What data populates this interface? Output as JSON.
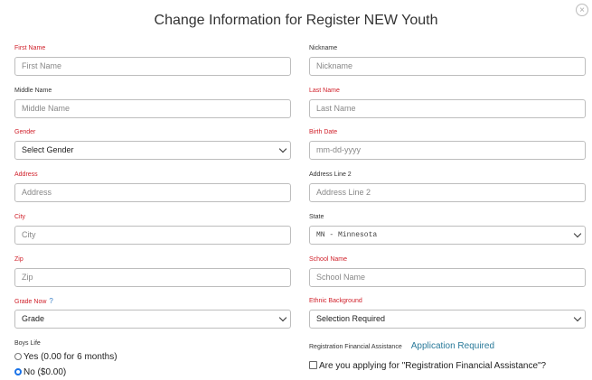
{
  "modal": {
    "title": "Change Information for Register NEW Youth",
    "close_glyph": "×"
  },
  "fields": {
    "first_name": {
      "label": "First Name",
      "placeholder": "First Name"
    },
    "nickname": {
      "label": "Nickname",
      "placeholder": "Nickname"
    },
    "middle_name": {
      "label": "Middle Name",
      "placeholder": "Middle Name"
    },
    "last_name": {
      "label": "Last Name",
      "placeholder": "Last Name"
    },
    "gender": {
      "label": "Gender",
      "value": "Select Gender"
    },
    "birth_date": {
      "label": "Birth Date",
      "placeholder": "mm-dd-yyyy"
    },
    "address": {
      "label": "Address",
      "placeholder": "Address"
    },
    "address2": {
      "label": "Address Line 2",
      "placeholder": "Address Line 2"
    },
    "city": {
      "label": "City",
      "placeholder": "City"
    },
    "state": {
      "label": "State",
      "value": "MN - Minnesota"
    },
    "zip": {
      "label": "Zip",
      "placeholder": "Zip"
    },
    "school": {
      "label": "School Name",
      "placeholder": "School Name"
    },
    "grade": {
      "label": "Grade Now",
      "help": "?",
      "value": "Grade"
    },
    "ethnic": {
      "label": "Ethnic Background",
      "value": "Selection Required"
    }
  },
  "boys_life": {
    "label": "Boys Life",
    "options": [
      {
        "label": "Yes (0.00 for 6 months)",
        "selected": false
      },
      {
        "label": "No ($0.00)",
        "selected": true
      }
    ]
  },
  "financial": {
    "label": "Registration Financial Assistance",
    "status": "Application Required",
    "checkbox_label": "Are you applying for \"Registration Financial Assistance\"?"
  },
  "colors": {
    "required_label": "#d0202a",
    "status": "#2a7a9a",
    "radio_selected": "#1a73e8"
  }
}
